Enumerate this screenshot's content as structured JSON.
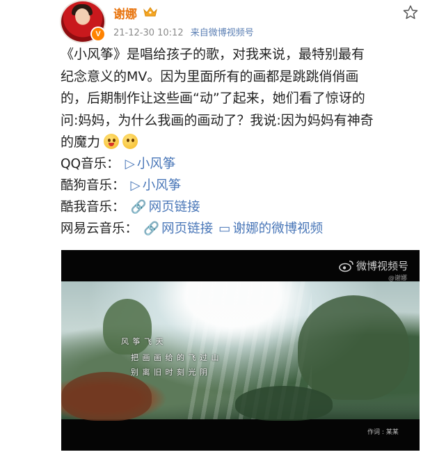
{
  "user": {
    "name": "谢娜",
    "verified_badge": "V",
    "member_icon": "crown-icon",
    "timestamp": "21-12-30 10:12",
    "source": "来自微博视频号"
  },
  "post": {
    "lines": [
      "《小风筝》是唱给孩子的歌，对我来说，最特别最有",
      "纪念意义的MV。因为里面所有的画都是跳跳俏俏画",
      "的，后期制作让这些画“动”了起来，她们看了惊讶的",
      "问:妈妈，为什么我画的画动了？我说:因为妈妈有神奇",
      "的魔力"
    ],
    "emojis": [
      "tongue-emoji",
      "awkward-emoji"
    ]
  },
  "music_links": [
    {
      "platform": "QQ音乐：",
      "links": [
        {
          "icon": "▷",
          "text": "小风筝"
        }
      ]
    },
    {
      "platform": "酷狗音乐：",
      "links": [
        {
          "icon": "▷",
          "text": "小风筝"
        }
      ]
    },
    {
      "platform": "酷我音乐：",
      "links": [
        {
          "icon": "🔗",
          "text": "网页链接"
        }
      ]
    },
    {
      "platform": "网易云音乐：",
      "links": [
        {
          "icon": "🔗",
          "text": "网页链接"
        },
        {
          "icon": "▭",
          "text": "谢娜的微博视频"
        }
      ]
    }
  ],
  "video": {
    "watermark": "微博视频号",
    "watermark_sub": "@谢娜",
    "lyrics": [
      "风 筝 飞 天",
      "把 画 画 给 的 飞 过 山",
      "别 离 旧 时 刻 光 阴"
    ],
    "credit": "作词 : 某某"
  },
  "colors": {
    "username": "#e8730c",
    "link": "#4a77b8",
    "meta": "#8a8a8a",
    "badge": "#ff8200"
  }
}
